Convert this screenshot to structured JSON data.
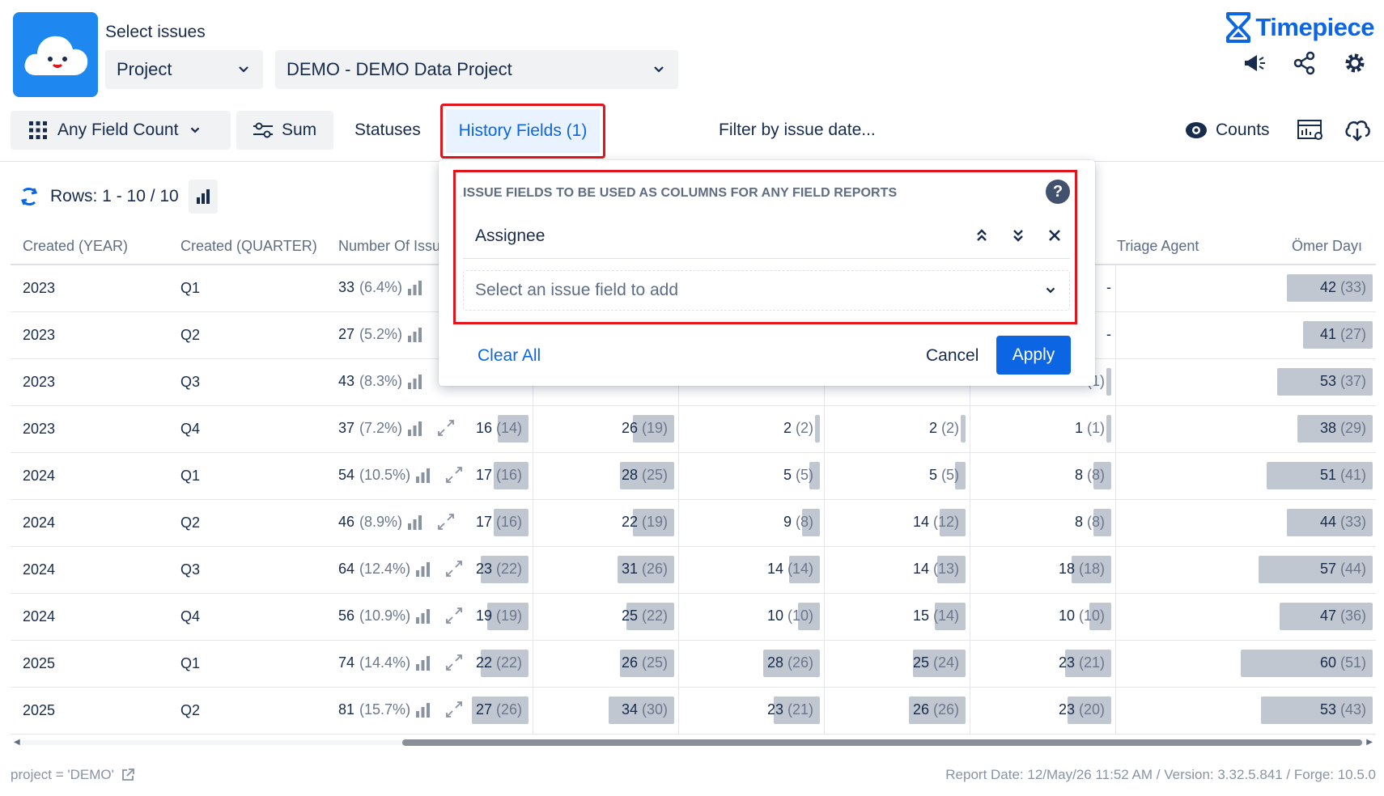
{
  "header": {
    "select_label": "Select issues",
    "project_dropdown": "Project",
    "project_value": "DEMO - DEMO Data Project",
    "brand_name": "Timepiece",
    "brand_color": "#0c66e4",
    "icons": [
      "megaphone-icon",
      "share-icon",
      "gear-icon"
    ]
  },
  "toolbar": {
    "any_field_count": "Any Field Count",
    "sum": "Sum",
    "statuses": "Statuses",
    "history_fields": "History Fields (1)",
    "filter": "Filter by issue date...",
    "counts": "Counts"
  },
  "rows": {
    "label": "Rows: 1 - 10 / 10"
  },
  "table": {
    "headers": {
      "year": "Created (YEAR)",
      "quarter": "Created (QUARTER)",
      "number": "Number Of Issu",
      "triage": "Triage Agent",
      "omer": "Ömer Dayı"
    },
    "rows": [
      {
        "year": "2023",
        "q": "Q1",
        "n": "33",
        "p": "(6.4%)",
        "c1": {
          "v": "",
          "s": ""
        },
        "c2": {
          "v": "",
          "s": ""
        },
        "c3": {
          "v": "",
          "s": ""
        },
        "c4": {
          "v": "",
          "s": ""
        },
        "c5": {
          "v": "-",
          "s": ""
        },
        "c6": {
          "v": "42",
          "s": "(33)"
        }
      },
      {
        "year": "2023",
        "q": "Q2",
        "n": "27",
        "p": "(5.2%)",
        "c1": {
          "v": "",
          "s": ""
        },
        "c2": {
          "v": "",
          "s": ""
        },
        "c3": {
          "v": "",
          "s": ""
        },
        "c4": {
          "v": "",
          "s": ""
        },
        "c5": {
          "v": "-",
          "s": ""
        },
        "c6": {
          "v": "41",
          "s": "(27)"
        }
      },
      {
        "year": "2023",
        "q": "Q3",
        "n": "43",
        "p": "(8.3%)",
        "c1": {
          "v": "",
          "s": ""
        },
        "c2": {
          "v": "",
          "s": ""
        },
        "c3": {
          "v": "",
          "s": ""
        },
        "c4": {
          "v": "",
          "s": ""
        },
        "c5": {
          "v": "1",
          "s": "(1)"
        },
        "c6": {
          "v": "53",
          "s": "(37)"
        }
      },
      {
        "year": "2023",
        "q": "Q4",
        "n": "37",
        "p": "(7.2%)",
        "c1": {
          "v": "16",
          "s": "(14)"
        },
        "c2": {
          "v": "26",
          "s": "(19)"
        },
        "c3": {
          "v": "2",
          "s": "(2)"
        },
        "c4": {
          "v": "2",
          "s": "(2)"
        },
        "c5": {
          "v": "1",
          "s": "(1)"
        },
        "c6": {
          "v": "38",
          "s": "(29)"
        }
      },
      {
        "year": "2024",
        "q": "Q1",
        "n": "54",
        "p": "(10.5%)",
        "c1": {
          "v": "17",
          "s": "(16)"
        },
        "c2": {
          "v": "28",
          "s": "(25)"
        },
        "c3": {
          "v": "5",
          "s": "(5)"
        },
        "c4": {
          "v": "5",
          "s": "(5)"
        },
        "c5": {
          "v": "8",
          "s": "(8)"
        },
        "c6": {
          "v": "51",
          "s": "(41)"
        }
      },
      {
        "year": "2024",
        "q": "Q2",
        "n": "46",
        "p": "(8.9%)",
        "c1": {
          "v": "17",
          "s": "(16)"
        },
        "c2": {
          "v": "22",
          "s": "(19)"
        },
        "c3": {
          "v": "9",
          "s": "(8)"
        },
        "c4": {
          "v": "14",
          "s": "(12)"
        },
        "c5": {
          "v": "8",
          "s": "(8)"
        },
        "c6": {
          "v": "44",
          "s": "(33)"
        }
      },
      {
        "year": "2024",
        "q": "Q3",
        "n": "64",
        "p": "(12.4%)",
        "c1": {
          "v": "23",
          "s": "(22)"
        },
        "c2": {
          "v": "31",
          "s": "(26)"
        },
        "c3": {
          "v": "14",
          "s": "(14)"
        },
        "c4": {
          "v": "14",
          "s": "(13)"
        },
        "c5": {
          "v": "18",
          "s": "(18)"
        },
        "c6": {
          "v": "57",
          "s": "(44)"
        }
      },
      {
        "year": "2024",
        "q": "Q4",
        "n": "56",
        "p": "(10.9%)",
        "c1": {
          "v": "19",
          "s": "(19)"
        },
        "c2": {
          "v": "25",
          "s": "(22)"
        },
        "c3": {
          "v": "10",
          "s": "(10)"
        },
        "c4": {
          "v": "15",
          "s": "(14)"
        },
        "c5": {
          "v": "10",
          "s": "(10)"
        },
        "c6": {
          "v": "47",
          "s": "(36)"
        }
      },
      {
        "year": "2025",
        "q": "Q1",
        "n": "74",
        "p": "(14.4%)",
        "c1": {
          "v": "22",
          "s": "(22)"
        },
        "c2": {
          "v": "26",
          "s": "(25)"
        },
        "c3": {
          "v": "28",
          "s": "(26)"
        },
        "c4": {
          "v": "25",
          "s": "(24)"
        },
        "c5": {
          "v": "23",
          "s": "(21)"
        },
        "c6": {
          "v": "60",
          "s": "(51)"
        }
      },
      {
        "year": "2025",
        "q": "Q2",
        "n": "81",
        "p": "(15.7%)",
        "c1": {
          "v": "27",
          "s": "(26)"
        },
        "c2": {
          "v": "34",
          "s": "(30)"
        },
        "c3": {
          "v": "23",
          "s": "(21)"
        },
        "c4": {
          "v": "26",
          "s": "(26)"
        },
        "c5": {
          "v": "23",
          "s": "(20)"
        },
        "c6": {
          "v": "53",
          "s": "(43)"
        }
      }
    ]
  },
  "popup": {
    "heading": "ISSUE FIELDS TO BE USED AS COLUMNS FOR ANY FIELD REPORTS",
    "field": "Assignee",
    "add_placeholder": "Select an issue field to add",
    "clear_all": "Clear All",
    "cancel": "Cancel",
    "apply": "Apply"
  },
  "footer": {
    "jql": "project = 'DEMO'",
    "report_info": "Report Date: 12/May/26 11:52 AM / Version: 3.32.5.841 / Forge: 10.5.0"
  }
}
